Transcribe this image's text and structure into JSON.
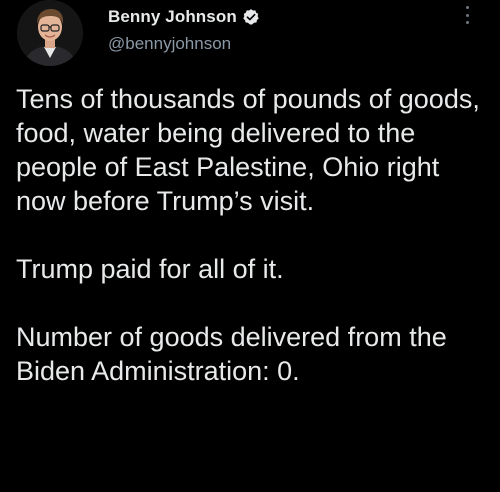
{
  "author": {
    "display_name": "Benny Johnson",
    "handle": "@bennyjohnson",
    "verified": true,
    "avatar_icon": "profile-photo"
  },
  "menu_icon": "more-vertical-icon",
  "tweet": {
    "paragraph_1": "Tens of thousands of pounds of goods, food, water being delivered to the people of East Palestine, Ohio right now before Trump’s visit.",
    "paragraph_2": "Trump paid for all of it.",
    "paragraph_3": "Number of goods delivered from the Biden Administration: 0."
  },
  "colors": {
    "background": "#000000",
    "text_primary": "#e7e9ea",
    "text_secondary": "#8b98a5",
    "verified_badge": "#1d9bf0"
  }
}
